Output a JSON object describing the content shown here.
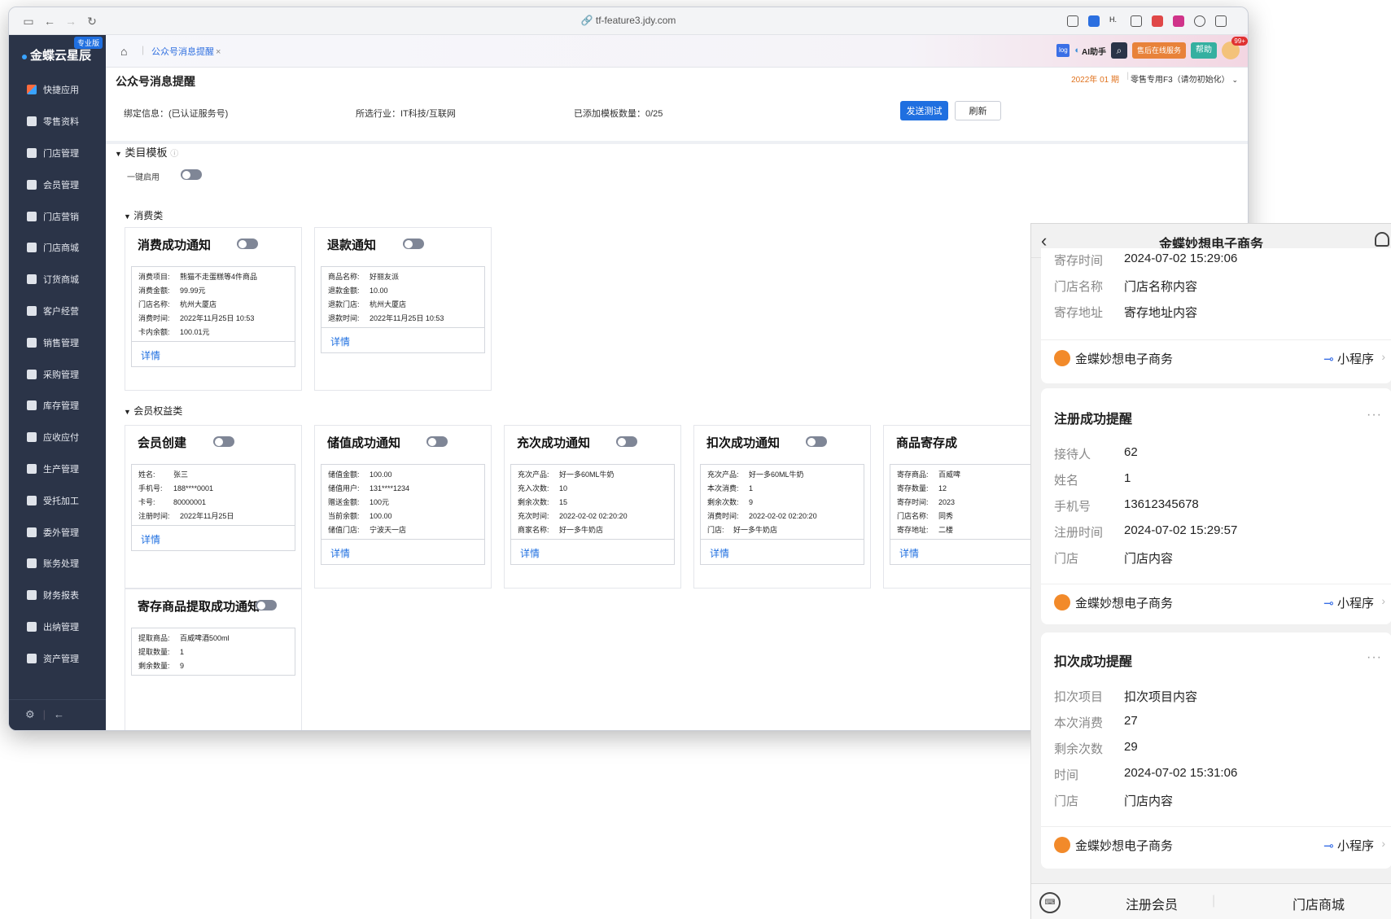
{
  "browser": {
    "url": "tf-feature3.jdy.com"
  },
  "sidebar": {
    "logo": "金蝶云星辰",
    "edition_badge": "专业版",
    "items": [
      {
        "label": "快捷应用"
      },
      {
        "label": "零售资料"
      },
      {
        "label": "门店管理"
      },
      {
        "label": "会员管理"
      },
      {
        "label": "门店营销"
      },
      {
        "label": "门店商城"
      },
      {
        "label": "订货商城"
      },
      {
        "label": "客户经营"
      },
      {
        "label": "销售管理"
      },
      {
        "label": "采购管理"
      },
      {
        "label": "库存管理"
      },
      {
        "label": "应收应付"
      },
      {
        "label": "生产管理"
      },
      {
        "label": "受托加工"
      },
      {
        "label": "委外管理"
      },
      {
        "label": "账务处理"
      },
      {
        "label": "财务报表"
      },
      {
        "label": "出纳管理"
      },
      {
        "label": "资产管理"
      }
    ]
  },
  "topbar": {
    "tab_label": "公众号消息提醒",
    "tab_close": "×",
    "log_label": "log",
    "ai_label": "AI助手",
    "service_label": "售后在线服务",
    "help_label": "帮助",
    "notif_count": "99+"
  },
  "page": {
    "title": "公众号消息提醒",
    "period": "2022年 01 期",
    "org": "零售专用F3（请勿初始化）",
    "binding_info": "绑定信息：(已认证服务号)",
    "industry_info": "所选行业：IT科技/互联网",
    "template_count": "已添加模板数量：0/25",
    "send_test_label": "发送测试",
    "refresh_label": "刷新",
    "category_section": "类目模板",
    "one_click_label": "一键启用",
    "consume_group": "消费类",
    "member_group": "会员权益类",
    "detail_label": "详情"
  },
  "cards": {
    "consume_success": {
      "title": "消费成功通知",
      "rows": [
        {
          "k": "消费项目:",
          "v": "熊猫不走蛋糕等4件商品"
        },
        {
          "k": "消费金额:",
          "v": "99.99元"
        },
        {
          "k": "门店名称:",
          "v": "杭州大厦店"
        },
        {
          "k": "消费时间:",
          "v": "2022年11月25日 10:53"
        },
        {
          "k": "卡内余额:",
          "v": "100.01元"
        }
      ]
    },
    "refund": {
      "title": "退款通知",
      "rows": [
        {
          "k": "商品名称:",
          "v": "好丽友派"
        },
        {
          "k": "退款金额:",
          "v": "10.00"
        },
        {
          "k": "退款门店:",
          "v": "杭州大厦店"
        },
        {
          "k": "退款时间:",
          "v": "2022年11月25日 10:53"
        }
      ]
    },
    "member_create": {
      "title": "会员创建",
      "rows": [
        {
          "k": "姓名:",
          "v": "张三"
        },
        {
          "k": "手机号:",
          "v": "188****0001"
        },
        {
          "k": "卡号:",
          "v": "80000001"
        },
        {
          "k": "注册时间:",
          "v": "2022年11月25日"
        }
      ]
    },
    "deposit_success": {
      "title": "储值成功通知",
      "rows": [
        {
          "k": "储值金额:",
          "v": "100.00"
        },
        {
          "k": "储值用户:",
          "v": "131****1234"
        },
        {
          "k": "赠送金额:",
          "v": "100元"
        },
        {
          "k": "当前余额:",
          "v": "100.00"
        },
        {
          "k": "储值门店:",
          "v": "宁波天一店"
        }
      ]
    },
    "recharge_times": {
      "title": "充次成功通知",
      "rows": [
        {
          "k": "充次产品:",
          "v": "好一多60ML牛奶"
        },
        {
          "k": "充入次数:",
          "v": "10"
        },
        {
          "k": "剩余次数:",
          "v": "15"
        },
        {
          "k": "充次时间:",
          "v": "2022-02-02 02:20:20"
        },
        {
          "k": "商家名称:",
          "v": "好一多牛奶店"
        }
      ]
    },
    "deduct_times": {
      "title": "扣次成功通知",
      "rows": [
        {
          "k": "充次产品:",
          "v": "好一多60ML牛奶"
        },
        {
          "k": "本次消费:",
          "v": "1"
        },
        {
          "k": "剩余次数:",
          "v": "9"
        },
        {
          "k": "消费时间:",
          "v": "2022-02-02 02:20:20"
        },
        {
          "k": "门店:",
          "v": "好一多牛奶店"
        }
      ]
    },
    "goods_deposit": {
      "title": "商品寄存成",
      "rows": [
        {
          "k": "寄存商品:",
          "v": "百威啤"
        },
        {
          "k": "寄存数量:",
          "v": "12"
        },
        {
          "k": "寄存时间:",
          "v": "2023"
        },
        {
          "k": "门店名称:",
          "v": "同秀"
        },
        {
          "k": "寄存地址:",
          "v": "二楼"
        }
      ]
    },
    "deposit_pickup": {
      "title": "寄存商品提取成功通知",
      "rows": [
        {
          "k": "提取商品:",
          "v": "百威啤酒500ml"
        },
        {
          "k": "提取数量:",
          "v": "1"
        },
        {
          "k": "剩余数量:",
          "v": "9"
        }
      ]
    }
  },
  "phone": {
    "title": "金蝶妙想电子商务",
    "top_partial": [
      {
        "k": "寄存时间",
        "v": "2024-07-02 15:29:06"
      },
      {
        "k": "门店名称",
        "v": "门店名称内容"
      },
      {
        "k": "寄存地址",
        "v": "寄存地址内容"
      }
    ],
    "register_msg": {
      "title": "注册成功提醒",
      "rows": [
        {
          "k": "接待人",
          "v": "62"
        },
        {
          "k": "姓名",
          "v": "1"
        },
        {
          "k": "手机号",
          "v": "13612345678"
        },
        {
          "k": "注册时间",
          "v": "2024-07-02 15:29:57"
        },
        {
          "k": "门店",
          "v": "门店内容"
        }
      ]
    },
    "deduct_msg": {
      "title": "扣次成功提醒",
      "rows": [
        {
          "k": "扣次项目",
          "v": "扣次项目内容"
        },
        {
          "k": "本次消费",
          "v": "27"
        },
        {
          "k": "剩余次数",
          "v": "29"
        },
        {
          "k": "时间",
          "v": "2024-07-02 15:31:06"
        },
        {
          "k": "门店",
          "v": "门店内容"
        }
      ]
    },
    "sender_name": "金蝶妙想电子商务",
    "mini_program": "小程序",
    "more": "···",
    "bottom_tabs": [
      "注册会员",
      "门店商城"
    ]
  }
}
